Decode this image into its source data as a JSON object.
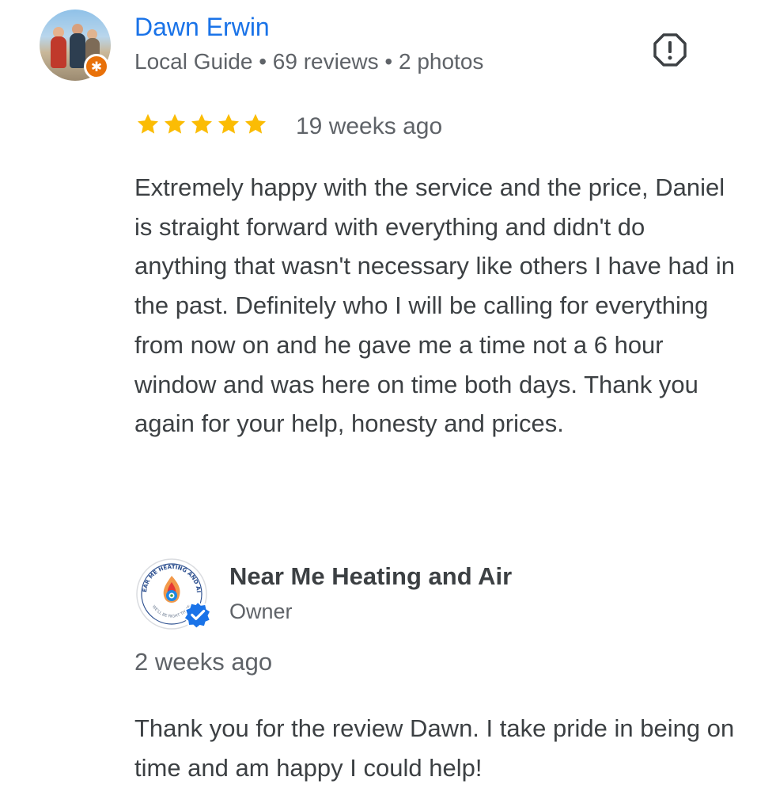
{
  "review": {
    "reviewer": {
      "name": "Dawn Erwin",
      "meta": "Local Guide • 69 reviews • 2 photos",
      "avatar_icon": "profile-photo",
      "badge_icon": "local-guide-star-icon"
    },
    "report_icon": "report-flag-icon",
    "rating": 5,
    "rating_max": 5,
    "date": "19 weeks ago",
    "text": "Extremely happy with the service and the price, Daniel is straight forward with everything and didn't do anything that wasn't necessary like others I have had in the past. Definitely who I will be calling for everything from now on and he gave me a time not a 6 hour window and was here on time both days. Thank you again for your help, honesty and prices."
  },
  "response": {
    "owner_name": "Near Me Heating and Air",
    "owner_role": "Owner",
    "logo_text_top": "NEAR ME HEATING AND AIR",
    "logo_text_bottom": "WE'LL BE RIGHT THERE",
    "date": "2 weeks ago",
    "text": "Thank you for the review Dawn. I take pride in being on time and am happy I could help!"
  },
  "colors": {
    "name_link": "#1a73e8",
    "star": "#fbbc04",
    "secondary_text": "#5f6368",
    "body_text": "#3c4043",
    "local_guide_badge": "#e8710a",
    "verified_badge": "#1a73e8"
  }
}
